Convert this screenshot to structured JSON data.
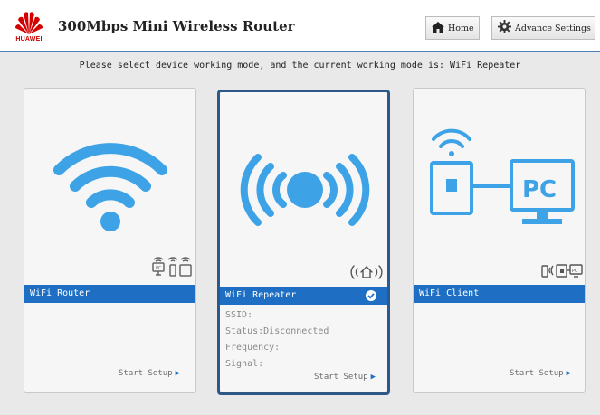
{
  "header": {
    "brand": "HUAWEI",
    "title": "300Mbps Mini Wireless Router",
    "home_label": "Home",
    "advance_label": "Advance Settings"
  },
  "notice": "Please select device working mode, and the current working mode is: WiFi Repeater",
  "modes": [
    {
      "label": "WiFi Router",
      "setup_label": "Start Setup",
      "selected": false
    },
    {
      "label": "WiFi Repeater",
      "setup_label": "Start Setup",
      "selected": true,
      "info": {
        "ssid_label": "SSID:",
        "status_label": "Status:",
        "status_value": "Disconnected",
        "frequency_label": "Frequency:",
        "signal_label": "Signal:"
      }
    },
    {
      "label": "WiFi Client",
      "setup_label": "Start Setup",
      "selected": false,
      "pc_text": "PC"
    }
  ],
  "colors": {
    "accent": "#1e6fc4",
    "illustration": "#3da3e6",
    "brand_red": "#cc0000"
  }
}
